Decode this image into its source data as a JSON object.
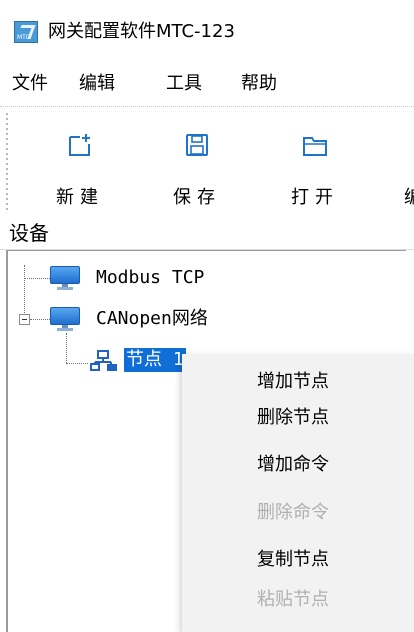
{
  "window": {
    "title": "网关配置软件MTC-123",
    "icon": "app-logo-icon",
    "icon_tag": "MTC"
  },
  "menubar": {
    "items": [
      {
        "label": "文件"
      },
      {
        "label": "编辑"
      },
      {
        "label": "工具"
      },
      {
        "label": "帮助"
      }
    ]
  },
  "toolbar": {
    "buttons": [
      {
        "label": "新建",
        "icon": "new-file-icon"
      },
      {
        "label": "保存",
        "icon": "save-icon"
      },
      {
        "label": "打开",
        "icon": "open-folder-icon"
      },
      {
        "label": "编",
        "icon": "edit-icon"
      }
    ]
  },
  "device_panel": {
    "header": "设备",
    "tree": [
      {
        "label": "Modbus TCP",
        "icon": "monitor-icon"
      },
      {
        "label": "CANopen网络",
        "icon": "monitor-icon",
        "expanded": true,
        "children": [
          {
            "label": "节点 1",
            "icon": "network-node-icon",
            "selected": true
          }
        ]
      }
    ]
  },
  "context_menu": {
    "items": [
      {
        "label": "增加节点",
        "enabled": true
      },
      {
        "label": "删除节点",
        "enabled": true
      },
      {
        "label": "增加命令",
        "enabled": true
      },
      {
        "label": "删除命令",
        "enabled": false
      },
      {
        "label": "复制节点",
        "enabled": true
      },
      {
        "label": "粘贴节点",
        "enabled": false
      }
    ]
  },
  "colors": {
    "selection": "#0f6fd6",
    "disabled_text": "#b0b0b0",
    "menu_background": "#f2f2f2"
  }
}
